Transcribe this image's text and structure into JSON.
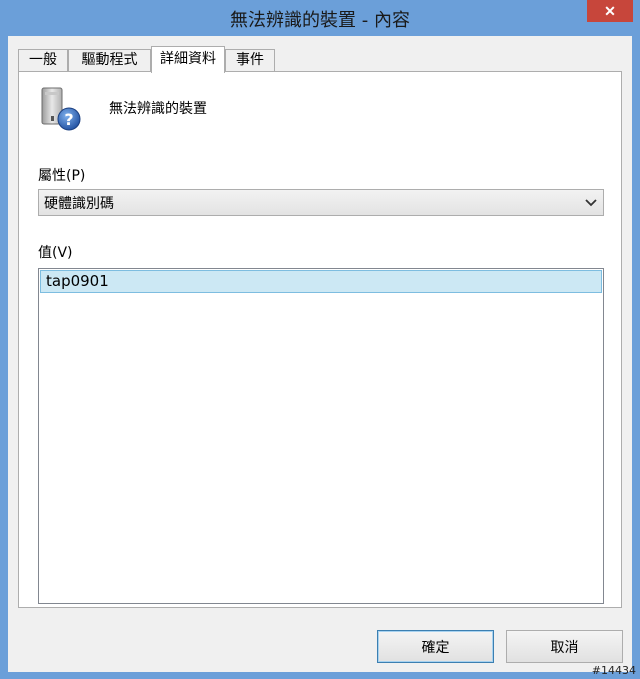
{
  "window": {
    "title": "無法辨識的裝置 - 內容",
    "close_glyph": "✕"
  },
  "tabs": [
    {
      "label": "一般",
      "active": false
    },
    {
      "label": "驅動程式",
      "active": false
    },
    {
      "label": "詳細資料",
      "active": true
    },
    {
      "label": "事件",
      "active": false
    }
  ],
  "device": {
    "icon": "unknown-device-icon",
    "name": "無法辨識的裝置"
  },
  "property": {
    "label": "屬性(P)",
    "selected": "硬體識別碼"
  },
  "value": {
    "label": "值(V)",
    "items": [
      "tap0901"
    ]
  },
  "buttons": {
    "ok": "確定",
    "cancel": "取消"
  },
  "watermark": "#14434"
}
